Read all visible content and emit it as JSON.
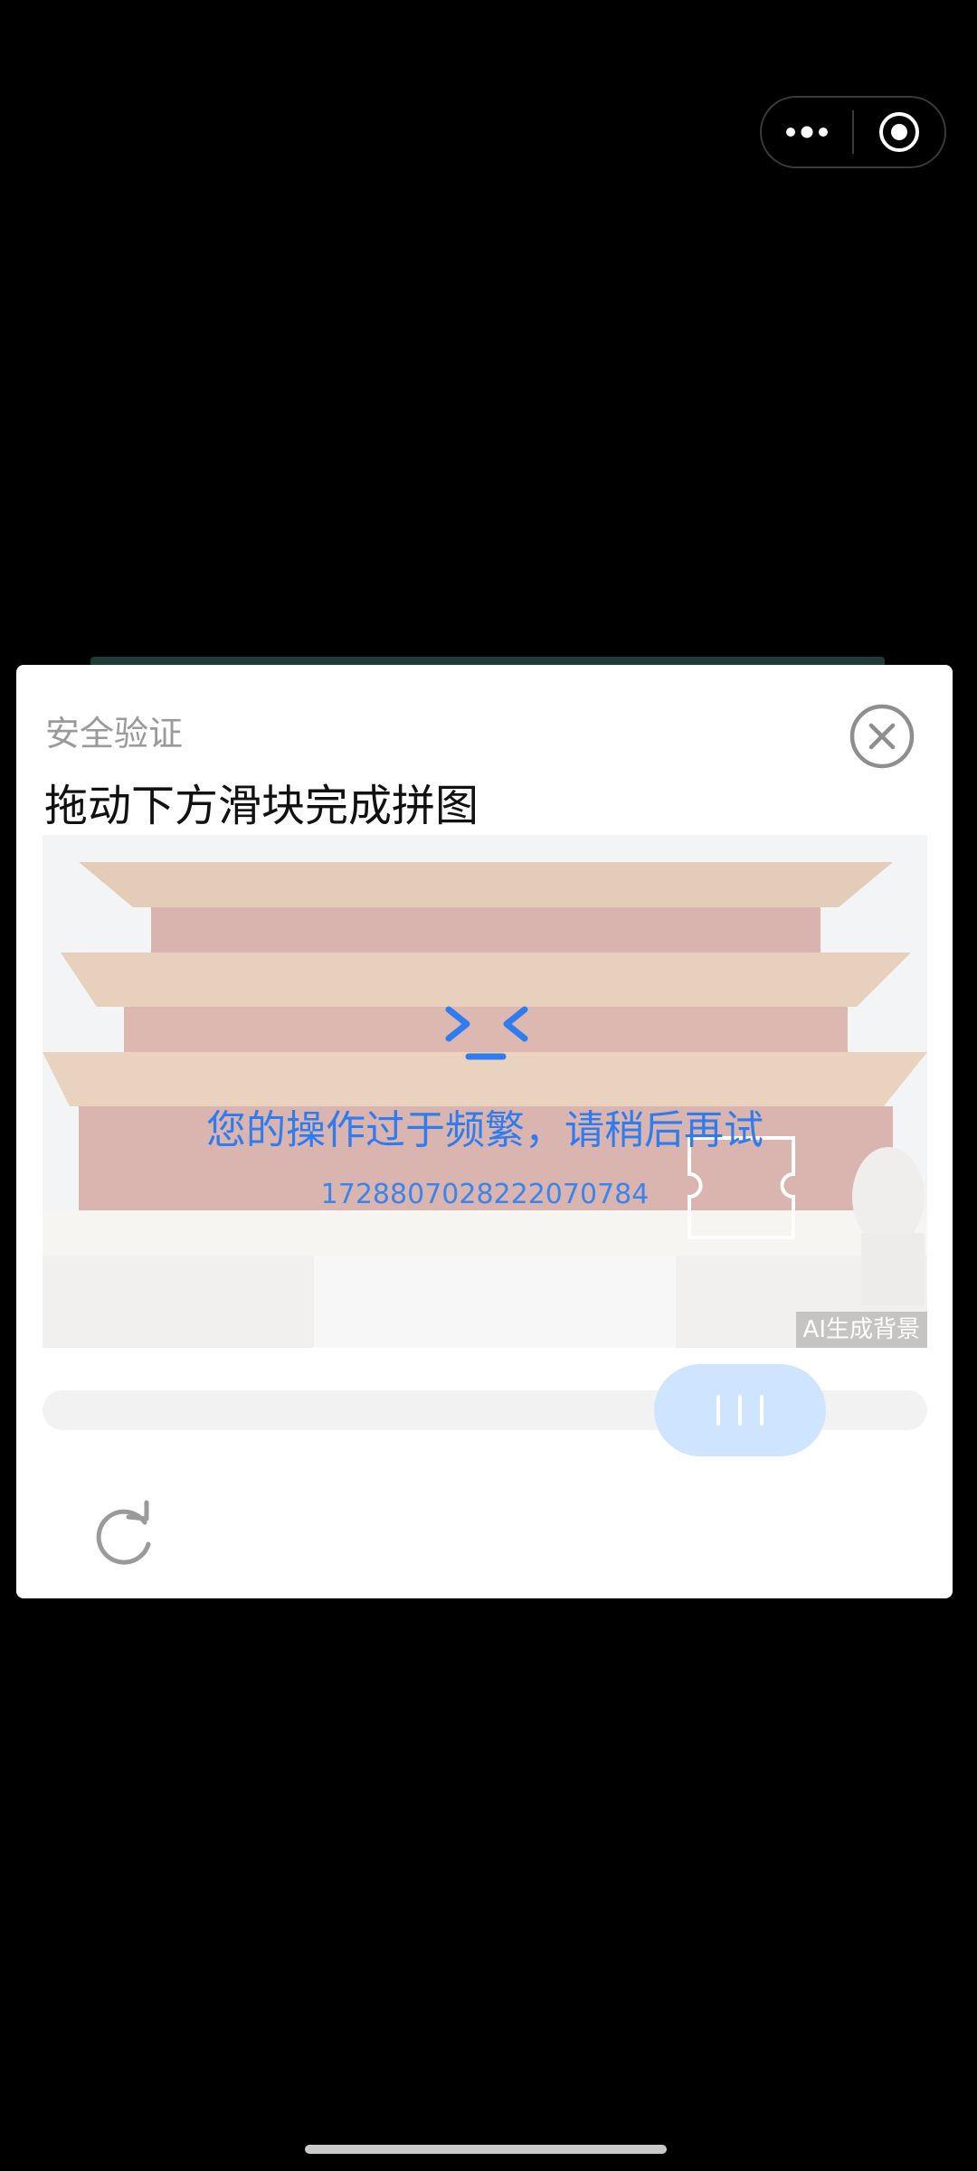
{
  "capsule": {
    "more_icon": "more-dots-icon",
    "exit_icon": "target-exit-icon"
  },
  "dialog": {
    "header": "安全验证",
    "title": "拖动下方滑块完成拼图",
    "close_icon": "close-circle-icon"
  },
  "captcha": {
    "error_message": "您的操作过于频繁，请稍后再试",
    "error_code": "1728807028222070784",
    "ai_badge": "AI生成背景",
    "face_icon": "sad-face-icon"
  },
  "slider": {
    "thumb_icon": "grip-lines-icon"
  },
  "refresh_icon": "refresh-icon",
  "colors": {
    "accent": "#2f7cf0",
    "thumb": "#cfe4ff",
    "track": "#f2f2f2"
  }
}
